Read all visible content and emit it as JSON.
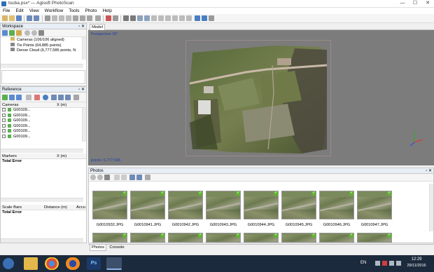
{
  "window": {
    "title": "tsuba.psx* — Agisoft PhotoScan",
    "minimize": "—",
    "maximize": "☐",
    "close": "✕"
  },
  "menu": [
    "File",
    "Edit",
    "View",
    "Workflow",
    "Tools",
    "Photo",
    "Help"
  ],
  "workspace": {
    "title": "Workspace",
    "items": [
      "Cameras (106/106 aligned)",
      "Tie Points (64,885 points)",
      "Dense Cloud (6,777,586 points, N"
    ]
  },
  "reference": {
    "title": "Reference",
    "cameras_header": "Cameras",
    "x_header": "X (m)",
    "camera_rows": [
      "G00109...",
      "G00109...",
      "G00109...",
      "G00109...",
      "G00109...",
      "G00109..."
    ],
    "markers_header": "Markers",
    "markers_x_header": "X (m)",
    "markers_total": "Total Error",
    "scalebars_header": "Scale Bars",
    "scalebars_distance": "Distance (m)",
    "scalebars_accuracy": "Accu",
    "scalebars_total": "Total Error"
  },
  "model": {
    "tab": "Model",
    "view_label": "Perspective 30°",
    "points_label": "points: 6,777,586"
  },
  "photos": {
    "title": "Photos",
    "row1": [
      "G0010932.JPG",
      "G0010941.JPG",
      "G0010942.JPG",
      "G0010943.JPG",
      "G0010944.JPG",
      "G0010945.JPG",
      "G0010946.JPG",
      "G0010947.JPG"
    ],
    "tabs": [
      "Photos",
      "Console"
    ]
  },
  "taskbar": {
    "lang": "EN",
    "time": "12:29",
    "date": "29/11/2016"
  },
  "colors": {
    "accent": "#2e6fb5",
    "check": "#62b233",
    "viewport": "#7c7c7c",
    "taskbar": "#1c2a3d"
  }
}
